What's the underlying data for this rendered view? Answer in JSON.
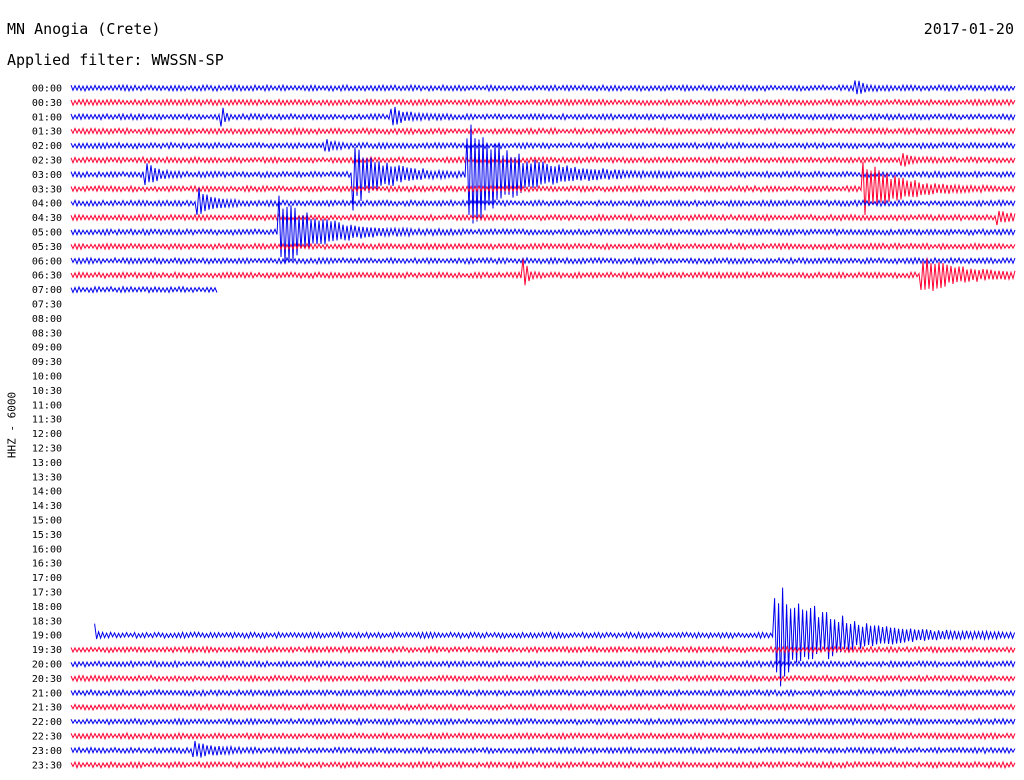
{
  "header": {
    "station": "MN Anogia (Crete)",
    "date": "2017-01-20",
    "filter": "Applied filter: WWSSN-SP"
  },
  "chart_data": {
    "type": "line",
    "title": "MN Anogia (Crete)",
    "ylabel": "HHZ - 6000",
    "colors": [
      "#0000ee",
      "#ff0033"
    ],
    "rows": [
      {
        "label": "00:00",
        "present": true,
        "start": 0,
        "end": 1,
        "color": "#0000ee",
        "events": [
          {
            "x": 0.83,
            "amp": 0.5,
            "dur": 0.01
          }
        ]
      },
      {
        "label": "00:30",
        "present": true,
        "start": 0,
        "end": 1,
        "color": "#ff0033",
        "events": []
      },
      {
        "label": "01:00",
        "present": true,
        "start": 0,
        "end": 1,
        "color": "#0000ee",
        "events": [
          {
            "x": 0.16,
            "amp": 0.5,
            "dur": 0.004
          },
          {
            "x": 0.34,
            "amp": 0.6,
            "dur": 0.015
          }
        ]
      },
      {
        "label": "01:30",
        "present": true,
        "start": 0,
        "end": 1,
        "color": "#ff0033",
        "events": []
      },
      {
        "label": "02:00",
        "present": true,
        "start": 0,
        "end": 1,
        "color": "#0000ee",
        "events": [
          {
            "x": 0.27,
            "amp": 0.3,
            "dur": 0.01
          }
        ]
      },
      {
        "label": "02:30",
        "present": true,
        "start": 0,
        "end": 1,
        "color": "#ff0033",
        "events": [
          {
            "x": 0.88,
            "amp": 0.3,
            "dur": 0.01
          }
        ]
      },
      {
        "label": "03:00",
        "present": true,
        "start": 0,
        "end": 1,
        "color": "#0000ee",
        "events": [
          {
            "x": 0.08,
            "amp": 0.7,
            "dur": 0.012
          },
          {
            "x": 0.3,
            "amp": 2.2,
            "dur": 0.03
          },
          {
            "x": 0.42,
            "amp": 3.5,
            "dur": 0.05
          }
        ]
      },
      {
        "label": "03:30",
        "present": true,
        "start": 0,
        "end": 1,
        "color": "#ff0033",
        "events": [
          {
            "x": 0.84,
            "amp": 1.8,
            "dur": 0.035
          }
        ]
      },
      {
        "label": "04:00",
        "present": true,
        "start": 0,
        "end": 1,
        "color": "#0000ee",
        "events": [
          {
            "x": 0.135,
            "amp": 0.9,
            "dur": 0.015
          }
        ]
      },
      {
        "label": "04:30",
        "present": true,
        "start": 0,
        "end": 1,
        "color": "#ff0033",
        "events": [
          {
            "x": 0.98,
            "amp": 0.4,
            "dur": 0.015
          }
        ]
      },
      {
        "label": "05:00",
        "present": true,
        "start": 0,
        "end": 1,
        "color": "#0000ee",
        "events": [
          {
            "x": 0.22,
            "amp": 2.5,
            "dur": 0.04
          }
        ]
      },
      {
        "label": "05:30",
        "present": true,
        "start": 0,
        "end": 1,
        "color": "#ff0033",
        "events": []
      },
      {
        "label": "06:00",
        "present": true,
        "start": 0,
        "end": 1,
        "color": "#0000ee",
        "events": []
      },
      {
        "label": "06:30",
        "present": true,
        "start": 0,
        "end": 1,
        "color": "#ff0033",
        "events": [
          {
            "x": 0.48,
            "amp": 0.9,
            "dur": 0.004
          },
          {
            "x": 0.9,
            "amp": 1.2,
            "dur": 0.04
          }
        ]
      },
      {
        "label": "07:00",
        "present": true,
        "start": 0,
        "end": 0.155,
        "color": "#0000ee",
        "events": []
      },
      {
        "label": "07:30",
        "present": false,
        "start": 0,
        "end": 0,
        "color": "#ff0033",
        "events": []
      },
      {
        "label": "08:00",
        "present": false,
        "start": 0,
        "end": 0,
        "color": "#0000ee",
        "events": []
      },
      {
        "label": "08:30",
        "present": false,
        "start": 0,
        "end": 0,
        "color": "#ff0033",
        "events": []
      },
      {
        "label": "09:00",
        "present": false,
        "start": 0,
        "end": 0,
        "color": "#0000ee",
        "events": []
      },
      {
        "label": "09:30",
        "present": false,
        "start": 0,
        "end": 0,
        "color": "#ff0033",
        "events": []
      },
      {
        "label": "10:00",
        "present": false,
        "start": 0,
        "end": 0,
        "color": "#0000ee",
        "events": []
      },
      {
        "label": "10:30",
        "present": false,
        "start": 0,
        "end": 0,
        "color": "#ff0033",
        "events": []
      },
      {
        "label": "11:00",
        "present": false,
        "start": 0,
        "end": 0,
        "color": "#0000ee",
        "events": []
      },
      {
        "label": "11:30",
        "present": false,
        "start": 0,
        "end": 0,
        "color": "#ff0033",
        "events": []
      },
      {
        "label": "12:00",
        "present": false,
        "start": 0,
        "end": 0,
        "color": "#0000ee",
        "events": []
      },
      {
        "label": "12:30",
        "present": false,
        "start": 0,
        "end": 0,
        "color": "#ff0033",
        "events": []
      },
      {
        "label": "13:00",
        "present": false,
        "start": 0,
        "end": 0,
        "color": "#0000ee",
        "events": []
      },
      {
        "label": "13:30",
        "present": false,
        "start": 0,
        "end": 0,
        "color": "#ff0033",
        "events": []
      },
      {
        "label": "14:00",
        "present": false,
        "start": 0,
        "end": 0,
        "color": "#0000ee",
        "events": []
      },
      {
        "label": "14:30",
        "present": false,
        "start": 0,
        "end": 0,
        "color": "#ff0033",
        "events": []
      },
      {
        "label": "15:00",
        "present": false,
        "start": 0,
        "end": 0,
        "color": "#0000ee",
        "events": []
      },
      {
        "label": "15:30",
        "present": false,
        "start": 0,
        "end": 0,
        "color": "#ff0033",
        "events": []
      },
      {
        "label": "16:00",
        "present": false,
        "start": 0,
        "end": 0,
        "color": "#0000ee",
        "events": []
      },
      {
        "label": "16:30",
        "present": false,
        "start": 0,
        "end": 0,
        "color": "#ff0033",
        "events": []
      },
      {
        "label": "17:00",
        "present": false,
        "start": 0,
        "end": 0,
        "color": "#0000ee",
        "events": []
      },
      {
        "label": "17:30",
        "present": false,
        "start": 0,
        "end": 0,
        "color": "#ff0033",
        "events": []
      },
      {
        "label": "18:00",
        "present": false,
        "start": 0,
        "end": 0,
        "color": "#0000ee",
        "events": []
      },
      {
        "label": "18:30",
        "present": false,
        "start": 0,
        "end": 0,
        "color": "#ff0033",
        "events": []
      },
      {
        "label": "19:00",
        "present": true,
        "start": 0.025,
        "end": 1,
        "color": "#0000ee",
        "events": [
          {
            "x": 0.025,
            "amp": 0.6,
            "dur": 0.002
          },
          {
            "x": 0.745,
            "amp": 3.5,
            "dur": 0.06
          }
        ]
      },
      {
        "label": "19:30",
        "present": true,
        "start": 0,
        "end": 1,
        "color": "#ff0033",
        "events": []
      },
      {
        "label": "20:00",
        "present": true,
        "start": 0,
        "end": 1,
        "color": "#0000ee",
        "events": []
      },
      {
        "label": "20:30",
        "present": true,
        "start": 0,
        "end": 1,
        "color": "#ff0033",
        "events": []
      },
      {
        "label": "21:00",
        "present": true,
        "start": 0,
        "end": 1,
        "color": "#0000ee",
        "events": []
      },
      {
        "label": "21:30",
        "present": true,
        "start": 0,
        "end": 1,
        "color": "#ff0033",
        "events": []
      },
      {
        "label": "22:00",
        "present": true,
        "start": 0,
        "end": 1,
        "color": "#0000ee",
        "events": []
      },
      {
        "label": "22:30",
        "present": true,
        "start": 0,
        "end": 1,
        "color": "#ff0033",
        "events": []
      },
      {
        "label": "23:00",
        "present": true,
        "start": 0,
        "end": 1,
        "color": "#0000ee",
        "events": [
          {
            "x": 0.13,
            "amp": 0.5,
            "dur": 0.02
          }
        ]
      },
      {
        "label": "23:30",
        "present": true,
        "start": 0,
        "end": 1,
        "color": "#ff0033",
        "events": []
      }
    ]
  }
}
